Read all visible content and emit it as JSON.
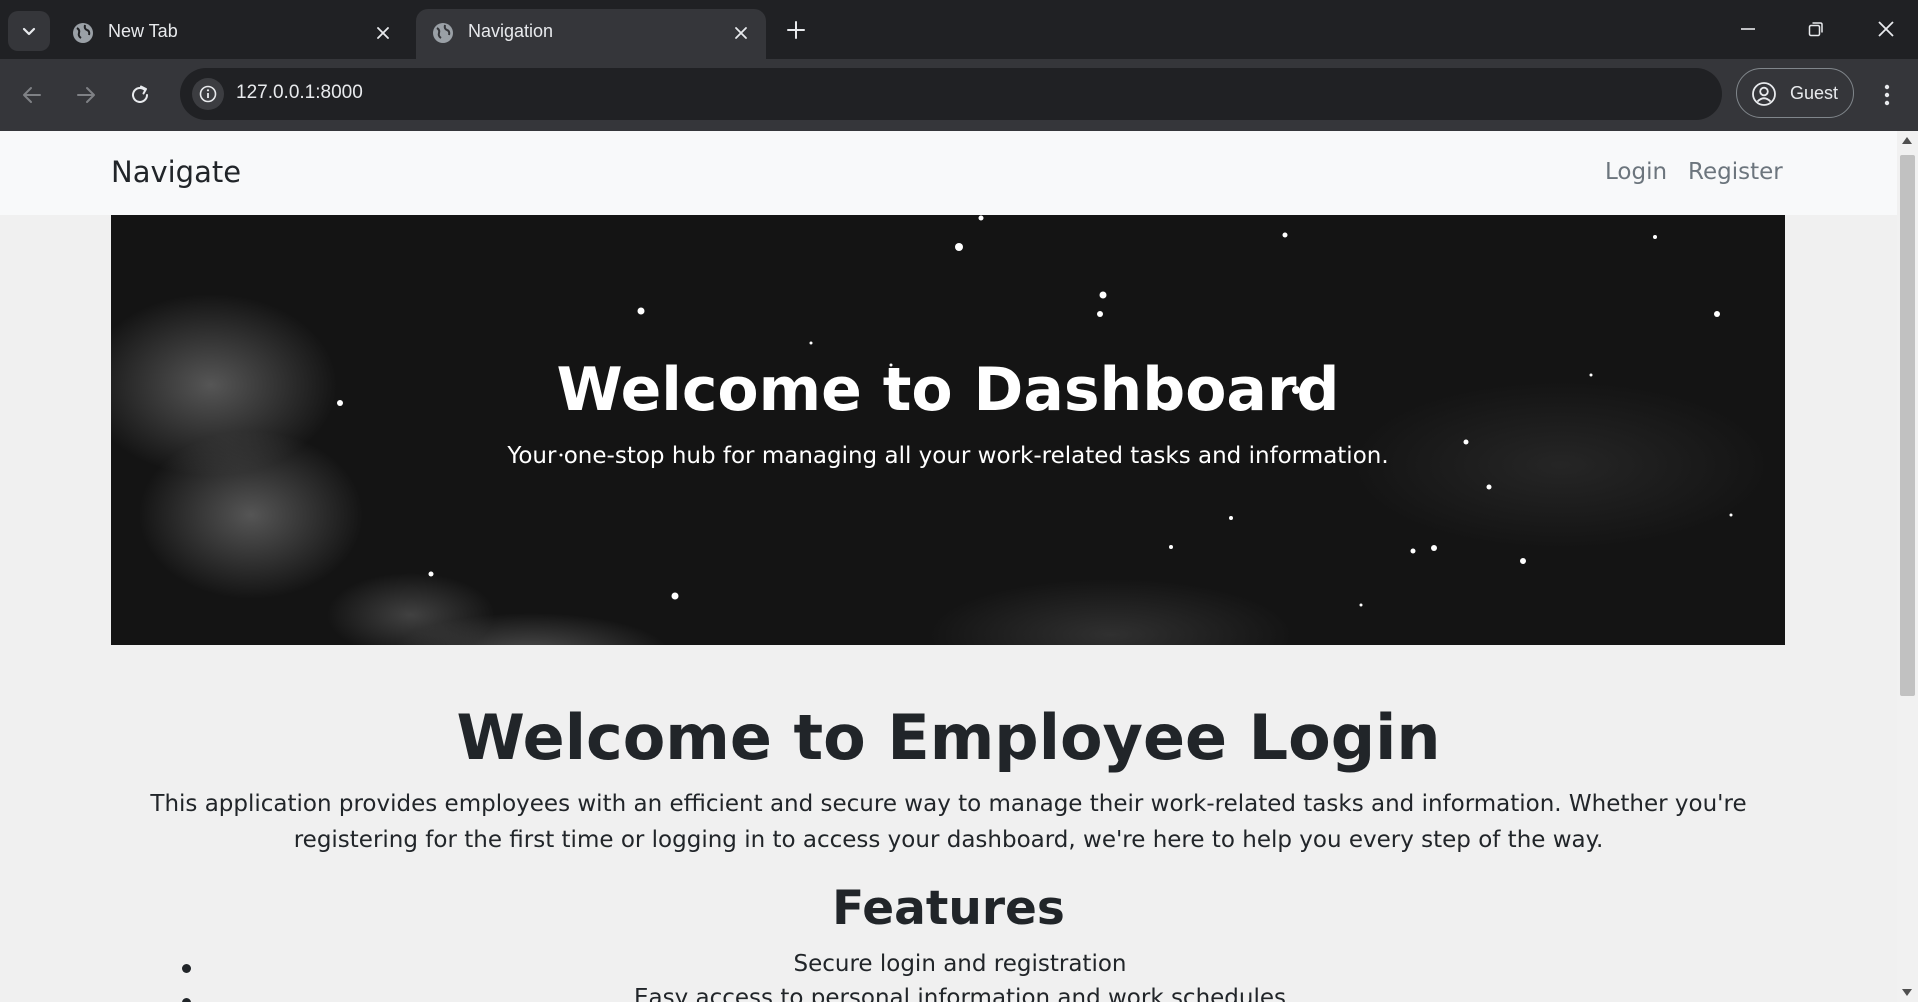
{
  "browser": {
    "tabs": [
      {
        "title": "New Tab",
        "active": false
      },
      {
        "title": "Navigation",
        "active": true
      }
    ],
    "url": "127.0.0.1:8000",
    "profile_label": "Guest"
  },
  "navbar": {
    "brand": "Navigate",
    "links": [
      "Login",
      "Register"
    ]
  },
  "hero": {
    "title": "Welcome to Dashboard",
    "subtitle": "Your one-stop hub for managing all your work-related tasks and information."
  },
  "content": {
    "title": "Welcome to Employee Login",
    "intro": "This application provides employees with an efficient and secure way to manage their work-related tasks and information. Whether you're registering for the first time or logging in to access your dashboard, we're here to help you every step of the way.",
    "features_title": "Features",
    "features": [
      "Secure login and registration",
      "Easy access to personal information and work schedules"
    ]
  },
  "colors": {
    "tabstrip": "#202124",
    "toolbar": "#35363a",
    "navbar_bg": "#f8f9fa",
    "page_bg": "#f0f0f0",
    "text": "#212529",
    "nav_link": "#6c757d"
  }
}
